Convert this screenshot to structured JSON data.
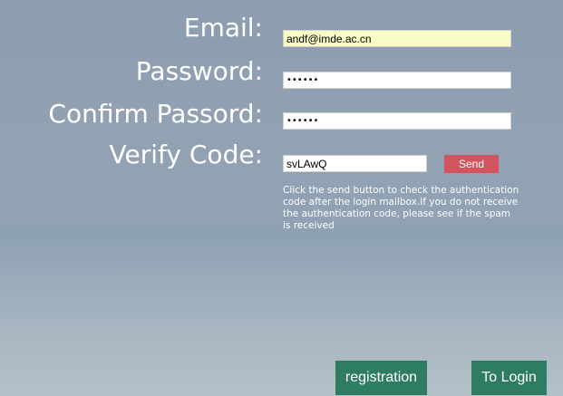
{
  "form": {
    "email_label": "Email:",
    "email_value": "andf@imde.ac.cn",
    "password_label": "Password:",
    "password_value": "••••••",
    "confirm_label": "Confirm Passord:",
    "confirm_value": "••••••",
    "verify_label": "Verify Code:",
    "verify_value": "svLAwQ",
    "send_label": "Send",
    "hint": "Click the send button to check the authentication code after the login mailbox.If you do not receive the authentication code, please see if the spam is received"
  },
  "actions": {
    "registration_label": "registration",
    "login_label": "To Login"
  },
  "colors": {
    "send_button": "#d35461",
    "action_buttons": "#2e7d63",
    "autofill_field": "#fafcc6"
  }
}
